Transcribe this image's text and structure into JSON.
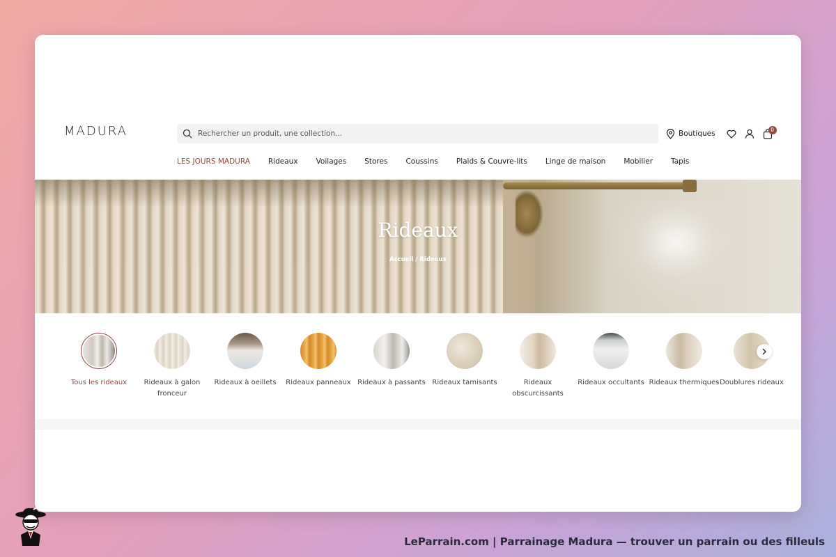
{
  "header": {
    "logo": "MADURA",
    "search_placeholder": "Rechercher un produit, une collection...",
    "boutiques_label": "Boutiques",
    "cart_count": "0"
  },
  "nav": [
    {
      "label": "LES JOURS MADURA"
    },
    {
      "label": "Rideaux"
    },
    {
      "label": "Voilages"
    },
    {
      "label": "Stores"
    },
    {
      "label": "Coussins"
    },
    {
      "label": "Plaids & Couvre-lits"
    },
    {
      "label": "Linge de maison"
    },
    {
      "label": "Mobilier"
    },
    {
      "label": "Tapis"
    }
  ],
  "hero": {
    "title": "Rideaux",
    "breadcrumb_home": "Accueil",
    "breadcrumb_sep": " / ",
    "breadcrumb_current": "Rideaux"
  },
  "categories": [
    {
      "label": "Tous les rideaux"
    },
    {
      "label": "Rideaux à galon fronceur"
    },
    {
      "label": "Rideaux à oeillets"
    },
    {
      "label": "Rideaux panneaux"
    },
    {
      "label": "Rideaux à passants"
    },
    {
      "label": "Rideaux tamisants"
    },
    {
      "label": "Rideaux obscurcissants"
    },
    {
      "label": "Rideaux occultants"
    },
    {
      "label": "Rideaux thermiques"
    },
    {
      "label": "Doublures rideaux"
    }
  ],
  "footer": {
    "text": "LeParrain.com | Parrainage Madura — trouver un parrain ou des filleuls"
  },
  "colors": {
    "accent": "#8b4a43"
  }
}
